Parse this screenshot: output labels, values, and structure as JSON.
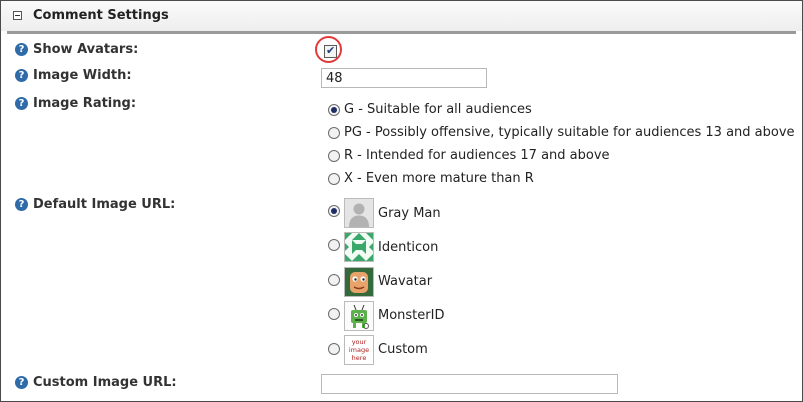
{
  "section": {
    "title": "Comment Settings"
  },
  "fields": {
    "show_avatars": {
      "label": "Show Avatars:",
      "checked": true
    },
    "image_width": {
      "label": "Image Width:",
      "value": "48"
    },
    "image_rating": {
      "label": "Image Rating:",
      "options": [
        "G - Suitable for all audiences",
        "PG - Possibly offensive, typically suitable for audiences 13 and above",
        "R - Intended for audiences 17 and above",
        "X - Even more mature than R"
      ],
      "selected_index": 0
    },
    "default_image_url": {
      "label": "Default Image URL:",
      "options": [
        "Gray Man",
        "Identicon",
        "Wavatar",
        "MonsterID",
        "Custom"
      ],
      "selected_index": 0,
      "custom_avatar_text": "your image here"
    },
    "custom_image_url": {
      "label": "Custom Image URL:",
      "value": ""
    }
  },
  "colors": {
    "help_icon": "#2f6ba8",
    "highlight": "#e23a3a",
    "header_rule": "#9a9a9a"
  }
}
